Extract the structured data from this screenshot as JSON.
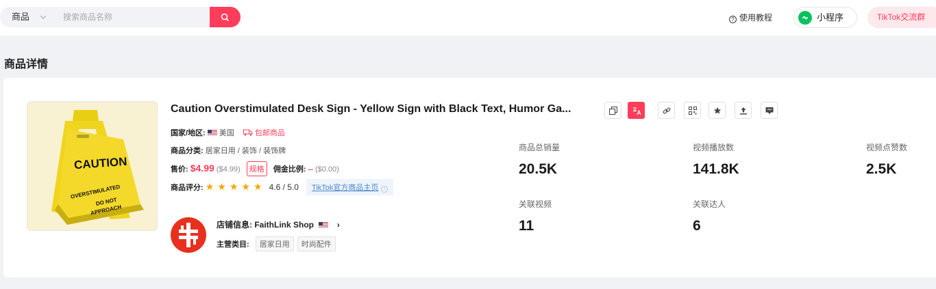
{
  "search": {
    "category": "商品",
    "placeholder": "搜索商品名称"
  },
  "header": {
    "tutorial": "使用教程",
    "mini_program": "小程序",
    "tiktok_group": "TikTok交流群"
  },
  "page_title": "商品详情",
  "product": {
    "title": "Caution Overstimulated Desk Sign - Yellow Sign with Black Text, Humor Ga...",
    "region_label": "国家/地区:",
    "region": "美国",
    "free_shipping": "包邮商品",
    "category_label": "商品分类:",
    "category": "居家日用 / 装饰 / 装饰牌",
    "price_label": "售价:",
    "price": "$4.99",
    "price_usd": "($4.99)",
    "spec": "规格",
    "commission_label": "佣金比例:",
    "commission": "--",
    "commission_usd": "($0.00)",
    "rating_label": "商品评分:",
    "rating": "4.6 / 5.0",
    "rating_value": 4.6,
    "tiktok_link": "TikTok官方商品主页",
    "image_text": {
      "line1": "CAUTION",
      "line2": "OVERSTIMULATED",
      "line3": "DO NOT",
      "line4": "APPROACH"
    }
  },
  "shop": {
    "label": "店铺信息:",
    "name": "FaithLink Shop",
    "main_cat_label": "主营类目:",
    "categories": [
      "居家日用",
      "时尚配件"
    ]
  },
  "actions": [
    {
      "icon": "copy-icon"
    },
    {
      "icon": "translate-icon"
    },
    {
      "icon": "link-icon"
    },
    {
      "icon": "qrcode-icon"
    },
    {
      "icon": "star-icon"
    },
    {
      "icon": "upload-icon"
    },
    {
      "icon": "message-icon"
    }
  ],
  "stats": {
    "total_sales": {
      "label": "商品总销量",
      "value": "20.5K"
    },
    "video_views": {
      "label": "视频播放数",
      "value": "141.8K"
    },
    "video_likes": {
      "label": "视频点赞数",
      "value": "2.5K"
    },
    "related_videos": {
      "label": "关联视频",
      "value": "11"
    },
    "related_creators": {
      "label": "关联达人",
      "value": "6"
    }
  },
  "colors": {
    "accent": "#ff3d5a",
    "star": "#f7a400",
    "wechat": "#07c160",
    "link": "#4a86c8"
  }
}
